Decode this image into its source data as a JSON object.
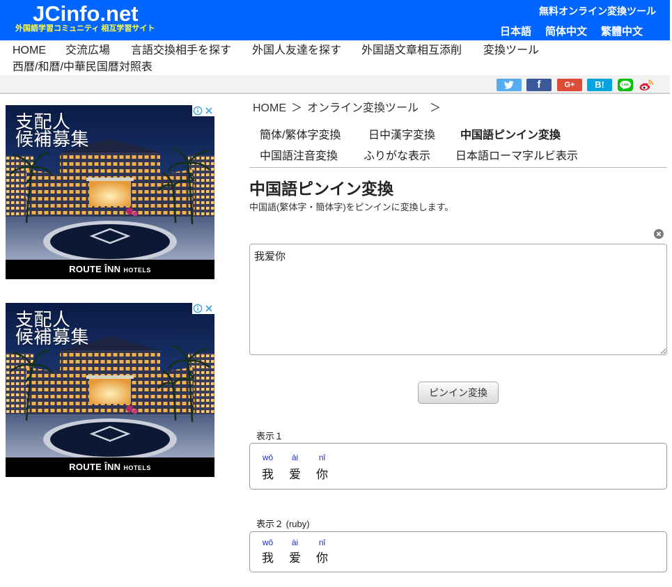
{
  "colors": {
    "header_bg": "#0066ff",
    "tagline": "#ffff55",
    "pinyin": "#1f2fd0",
    "share_bar": "#f2f2f2"
  },
  "header": {
    "logo": "JCinfo.net",
    "tagline": "外国語学習コミュニティ 相互学習サイト",
    "tool_link": "無料オンライン変換ツール",
    "languages": [
      "日本語",
      "简体中文",
      "繁體中文"
    ]
  },
  "nav": {
    "items": [
      "HOME",
      "交流広場",
      "言語交換相手を探す",
      "外国人友達を探す",
      "外国語文章相互添削",
      "変換ツール",
      "西暦/和暦/中華民国暦対照表"
    ]
  },
  "share": {
    "buttons": [
      {
        "icon": "twitter-icon",
        "color": "#55acee"
      },
      {
        "icon": "facebook-icon",
        "glyph": "f",
        "color": "#3b5998"
      },
      {
        "icon": "google-plus-icon",
        "glyph": "G+",
        "color": "#dd4b39"
      },
      {
        "icon": "hatena-bookmark-icon",
        "glyph": "B!",
        "color": "#00a4de"
      },
      {
        "icon": "line-icon",
        "glyph": "LINE",
        "color": "#00c300"
      },
      {
        "icon": "weibo-icon",
        "color": "#e6162d"
      }
    ]
  },
  "ads": [
    {
      "headline": [
        "支配人",
        "候補募集"
      ],
      "brand": "ROUTE ÎNN",
      "brand_suffix": "HOTELS",
      "badge_icons": [
        "info-icon",
        "close-icon"
      ]
    },
    {
      "headline": [
        "支配人",
        "候補募集"
      ],
      "brand": "ROUTE ÎNN",
      "brand_suffix": "HOTELS",
      "badge_icons": [
        "info-icon",
        "close-icon"
      ]
    }
  ],
  "breadcrumb": {
    "items": [
      "HOME",
      "オンライン変換ツール"
    ],
    "separator": "＞"
  },
  "tabs": [
    {
      "label": "簡体/繁体字変換",
      "active": false
    },
    {
      "label": "日中漢字変換",
      "active": false
    },
    {
      "label": "中国語ピンイン変換",
      "active": true
    },
    {
      "label": "中国語注音変換",
      "active": false
    },
    {
      "label": "ふりがな表示",
      "active": false
    },
    {
      "label": "日本語ローマ字ルビ表示",
      "active": false
    }
  ],
  "tool": {
    "title": "中国語ピンイン変換",
    "description": "中国語(繁体字・簡体字)をピンインに変換します。",
    "clear_icon": "clear-icon",
    "input_value": "我爱你",
    "button_label": "ピンイン変換"
  },
  "results": [
    {
      "label": "表示１",
      "tokens": [
        {
          "pinyin": "wǒ",
          "char": "我"
        },
        {
          "pinyin": "ài",
          "char": "爱"
        },
        {
          "pinyin": "nǐ",
          "char": "你"
        }
      ]
    },
    {
      "label": "表示２ (ruby)",
      "tokens": [
        {
          "pinyin": "wǒ",
          "char": "我"
        },
        {
          "pinyin": "ài",
          "char": "爱"
        },
        {
          "pinyin": "nǐ",
          "char": "你"
        }
      ]
    }
  ]
}
